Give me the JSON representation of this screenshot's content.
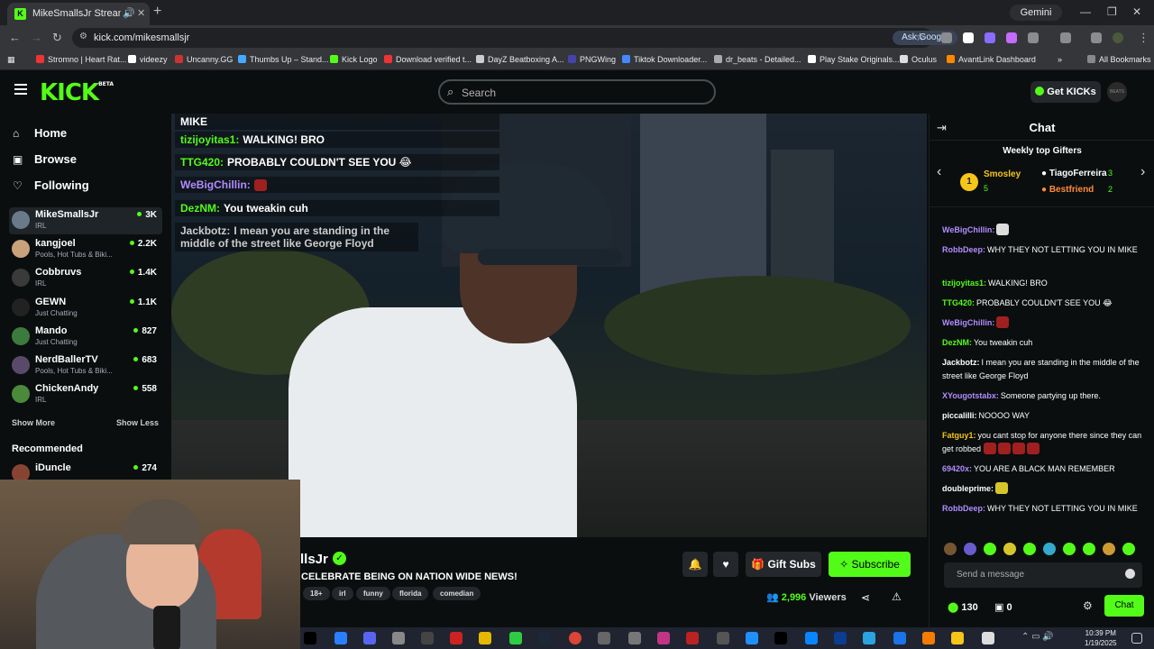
{
  "browser": {
    "tab_title": "MikeSmallsJr Stream - Watch",
    "gemini_label": "Gemini",
    "url": "kick.com/mikesmallsjr",
    "ask_google": "Ask Google",
    "bookmarks": [
      "Stromno | Heart Rat...",
      "videezy",
      "Uncanny.GG",
      "Thumbs Up – Stand...",
      "Kick Logo",
      "Download verified t...",
      "DayZ Beatboxing A...",
      "PNGWing",
      "Tiktok Downloader...",
      "dr_beats - Detailed...",
      "Play Stake Originals...",
      "Oculus",
      "AvantLink Dashboard"
    ],
    "all_bookmarks": "All Bookmarks"
  },
  "header": {
    "logo": "KICK",
    "logo_beta": "BETA",
    "search_placeholder": "Search",
    "get_kicks": "Get KICKs",
    "avatar_text": "BEATS"
  },
  "sidebar": {
    "nav": [
      {
        "label": "Home",
        "icon": "home-icon"
      },
      {
        "label": "Browse",
        "icon": "browse-icon"
      },
      {
        "label": "Following",
        "icon": "heart-icon"
      }
    ],
    "channels": [
      {
        "name": "MikeSmallsJr",
        "category": "IRL",
        "viewers": "3K",
        "color": "#6b7a8a"
      },
      {
        "name": "kangjoel",
        "category": "Pools, Hot Tubs & Biki...",
        "viewers": "2.2K",
        "color": "#c9a27c"
      },
      {
        "name": "Cobbruvs",
        "category": "IRL",
        "viewers": "1.4K",
        "color": "#3a3a3a"
      },
      {
        "name": "GEWN",
        "category": "Just Chatting",
        "viewers": "1.1K",
        "color": "#222222"
      },
      {
        "name": "Mando",
        "category": "Just Chatting",
        "viewers": "827",
        "color": "#3d7a3d"
      },
      {
        "name": "NerdBallerTV",
        "category": "Pools, Hot Tubs & Biki...",
        "viewers": "683",
        "color": "#5a4a6a"
      },
      {
        "name": "ChickenAndy",
        "category": "IRL",
        "viewers": "558",
        "color": "#4a8a3a"
      }
    ],
    "show_more": "Show More",
    "show_less": "Show Less",
    "recommended": "Recommended",
    "recommended_channel": {
      "name": "iDuncle",
      "viewers": "274"
    }
  },
  "video_overlay_chat": [
    {
      "user": "",
      "text": "MIKE",
      "color": "#ffffff"
    },
    {
      "user": "tizijoyitas1:",
      "text": "WALKING! BRO",
      "color": "#53fc18"
    },
    {
      "user": "TTG420:",
      "text": "PROBABLY COULDN'T SEE YOU 😂",
      "color": "#53fc18"
    },
    {
      "user": "WeBigChillin:",
      "text": "",
      "color": "#b18cff"
    },
    {
      "user": "DezNM:",
      "text": "You tweakin cuh",
      "color": "#53fc18"
    },
    {
      "user": "Jackbotz:",
      "text": "I mean you are standing in the middle of the street like George Floyd",
      "color": "#cccccc"
    }
  ],
  "stream": {
    "name": "llsJr",
    "title": "CELEBRATE BEING ON NATION WIDE NEWS!",
    "tags": [
      "18+",
      "irl",
      "funny",
      "florida",
      "comedian"
    ],
    "gift_subs": "Gift Subs",
    "subscribe": "Subscribe",
    "viewers": "2,996",
    "viewers_label": "Viewers"
  },
  "chat": {
    "title": "Chat",
    "weekly_title": "Weekly top Gifters",
    "gifters": [
      {
        "rank": "1",
        "name": "Smosley",
        "count": "5",
        "color": "#f5c518"
      },
      {
        "name": "TiagoFerreira",
        "count": "3",
        "color": "#ffffff"
      },
      {
        "name": "Bestfriend",
        "count": "2",
        "color": "#ff8c3a"
      }
    ],
    "messages": [
      {
        "user": "WeBigChillin:",
        "text": "",
        "color": "#b18cff"
      },
      {
        "user": "RobbDeep:",
        "text": "WHY THEY NOT LETTING YOU IN MIKE",
        "color": "#b18cff"
      },
      {
        "user": "tizijoyitas1:",
        "text": "WALKING! BRO",
        "color": "#53fc18"
      },
      {
        "user": "TTG420:",
        "text": "PROBABLY COULDN'T SEE YOU 😂",
        "color": "#53fc18"
      },
      {
        "user": "WeBigChillin:",
        "text": "",
        "color": "#b18cff"
      },
      {
        "user": "DezNM:",
        "text": "You tweakin cuh",
        "color": "#53fc18"
      },
      {
        "user": "Jackbotz:",
        "text": "I mean you are standing in the middle of the street like George Floyd",
        "color": "#ffffff"
      },
      {
        "user": "XYougotstabx:",
        "text": "Someone partying up there.",
        "color": "#b18cff"
      },
      {
        "user": "piccalilli:",
        "text": "NOOOO WAY",
        "color": "#ffffff"
      },
      {
        "user": "Fatguy1:",
        "text": "you cant stop for anyone there since they can get robbed",
        "color": "#f5c518"
      },
      {
        "user": "69420x:",
        "text": "YOU ARE A BLACK MAN REMEMBER",
        "color": "#b18cff"
      },
      {
        "user": "doubleprime:",
        "text": "",
        "color": "#ffffff"
      },
      {
        "user": "RobbDeep:",
        "text": "WHY THEY NOT LETTING YOU IN MIKE",
        "color": "#b18cff"
      }
    ],
    "send_placeholder": "Send a message",
    "kicks_count": "130",
    "gift_count": "0",
    "chat_button": "Chat"
  },
  "taskbar": {
    "time": "10:39 PM",
    "date": "1/19/2025"
  }
}
